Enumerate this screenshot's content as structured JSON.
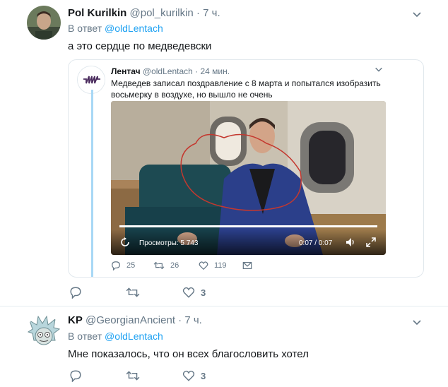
{
  "tweets": [
    {
      "author_name": "Pol Kurilkin",
      "handle": "@pol_kurilkin",
      "time": "· 7 ч.",
      "reply_prefix": "В ответ",
      "reply_to": "@oldLentach",
      "text": "а это сердце по медведевски",
      "quoted": {
        "author_name": "Лентач",
        "handle": "@oldLentach",
        "time": "· 24 мин.",
        "text": "Медведев записал поздравление с 8 марта и попытался изобразить восьмерку в воздухе, но вышло не очень",
        "video": {
          "views_label": "Просмотры: 5 743",
          "time_label": "0:07 / 0:07",
          "progress": 1.0
        },
        "actions": {
          "replies": "25",
          "retweets": "26",
          "likes": "119"
        }
      },
      "actions": {
        "replies": "",
        "retweets": "",
        "likes": "3"
      }
    },
    {
      "author_name": "KP",
      "handle": "@GeorgianAncient",
      "time": "· 7 ч.",
      "reply_prefix": "В ответ",
      "reply_to": "@oldLentach",
      "text": "Мне показалось, что он всех благословить хотел",
      "actions": {
        "replies": "",
        "retweets": "",
        "likes": "3"
      }
    }
  ],
  "icons": {
    "reply": "reply-icon",
    "retweet": "retweet-icon",
    "like": "heart-icon",
    "dm": "envelope-icon",
    "more": "chevron-down-icon",
    "play": "replay-icon",
    "volume": "volume-icon",
    "fullscreen": "fullscreen-icon"
  },
  "colors": {
    "link": "#1da1f2",
    "muted": "#657786",
    "thread": "#a8d8f5"
  }
}
